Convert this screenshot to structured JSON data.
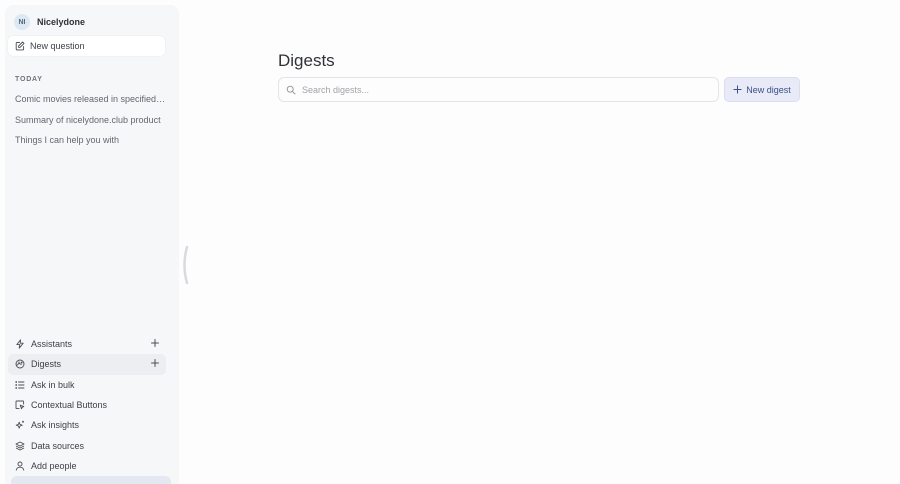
{
  "workspace": {
    "initials": "NI",
    "name": "Nicelydone"
  },
  "sidebar": {
    "new_question_label": "New question",
    "section_label": "TODAY",
    "history": [
      {
        "label": "Comic movies released in specified dates"
      },
      {
        "label": "Summary of nicelydone.club product"
      },
      {
        "label": "Things I can help you with"
      }
    ],
    "nav": [
      {
        "label": "Assistants",
        "icon": "bolt-icon",
        "has_add": true,
        "active": false
      },
      {
        "label": "Digests",
        "icon": "digest-icon",
        "has_add": true,
        "active": true
      },
      {
        "label": "Ask in bulk",
        "icon": "list-icon",
        "has_add": false,
        "active": false
      },
      {
        "label": "Contextual Buttons",
        "icon": "contextual-buttons-icon",
        "has_add": false,
        "active": false
      },
      {
        "label": "Ask insights",
        "icon": "sparkle-icon",
        "has_add": false,
        "active": false
      },
      {
        "label": "Data sources",
        "icon": "layers-icon",
        "has_add": false,
        "active": false
      },
      {
        "label": "Add people",
        "icon": "user-icon",
        "has_add": false,
        "active": false
      }
    ]
  },
  "main": {
    "title": "Digests",
    "search": {
      "placeholder": "Search digests...",
      "value": ""
    },
    "new_digest_label": "New digest"
  },
  "colors": {
    "sidebar_bg": "#f6f7f8",
    "active_nav_bg": "#eceef1",
    "primary_button_bg": "#e8ebf7",
    "primary_button_text": "#3c4f86"
  }
}
